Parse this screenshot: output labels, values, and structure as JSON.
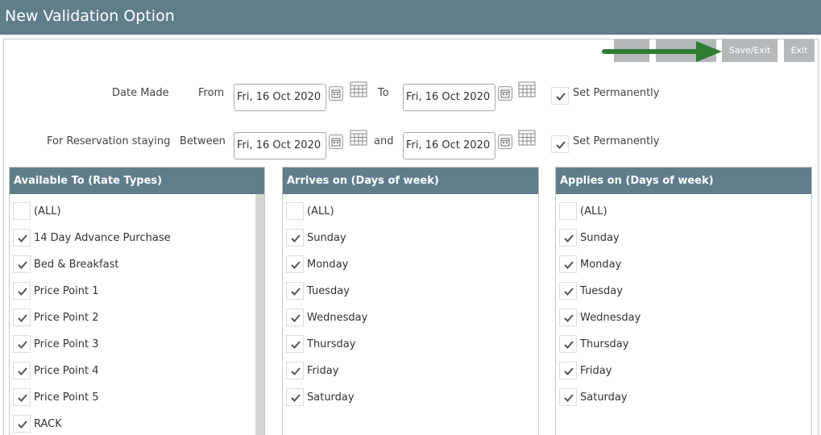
{
  "window": {
    "title": "New Validation Option"
  },
  "toolbar": {
    "save_exit_label": "Save/Exit",
    "exit_label": "Exit"
  },
  "filters": {
    "date_made": {
      "label": "Date Made",
      "from_label": "From",
      "to_label": "To",
      "from_value": "Fri, 16 Oct 2020",
      "to_value": "Fri, 16 Oct 2020",
      "set_permanently_label": "Set Permanently",
      "set_permanently_checked": true
    },
    "reservation_staying": {
      "label": "For Reservation staying",
      "between_label": "Between",
      "and_label": "and",
      "from_value": "Fri, 16 Oct 2020",
      "to_value": "Fri, 16 Oct 2020",
      "set_permanently_label": "Set Permanently",
      "set_permanently_checked": true
    }
  },
  "lists": [
    {
      "header": "Available To (Rate Types)",
      "items": [
        {
          "label": "(ALL)",
          "checked": false
        },
        {
          "label": "14 Day Advance Purchase",
          "checked": true
        },
        {
          "label": "Bed & Breakfast",
          "checked": true
        },
        {
          "label": "Price Point 1",
          "checked": true
        },
        {
          "label": "Price Point 2",
          "checked": true
        },
        {
          "label": "Price Point 3",
          "checked": true
        },
        {
          "label": "Price Point 4",
          "checked": true
        },
        {
          "label": "Price Point 5",
          "checked": true
        },
        {
          "label": "RACK",
          "checked": true
        }
      ]
    },
    {
      "header": "Arrives on (Days of week)",
      "items": [
        {
          "label": "(ALL)",
          "checked": false
        },
        {
          "label": "Sunday",
          "checked": true
        },
        {
          "label": "Monday",
          "checked": true
        },
        {
          "label": "Tuesday",
          "checked": true
        },
        {
          "label": "Wednesday",
          "checked": true
        },
        {
          "label": "Thursday",
          "checked": true
        },
        {
          "label": "Friday",
          "checked": true
        },
        {
          "label": "Saturday",
          "checked": true
        }
      ]
    },
    {
      "header": "Applies on (Days of week)",
      "items": [
        {
          "label": "(ALL)",
          "checked": false
        },
        {
          "label": "Sunday",
          "checked": true
        },
        {
          "label": "Monday",
          "checked": true
        },
        {
          "label": "Tuesday",
          "checked": true
        },
        {
          "label": "Wednesday",
          "checked": true
        },
        {
          "label": "Thursday",
          "checked": true
        },
        {
          "label": "Friday",
          "checked": true
        },
        {
          "label": "Saturday",
          "checked": true
        }
      ]
    }
  ],
  "colors": {
    "header": "#607d8b",
    "button": "#b4b9bc",
    "arrow": "#2e7d32",
    "check": "#555555"
  }
}
